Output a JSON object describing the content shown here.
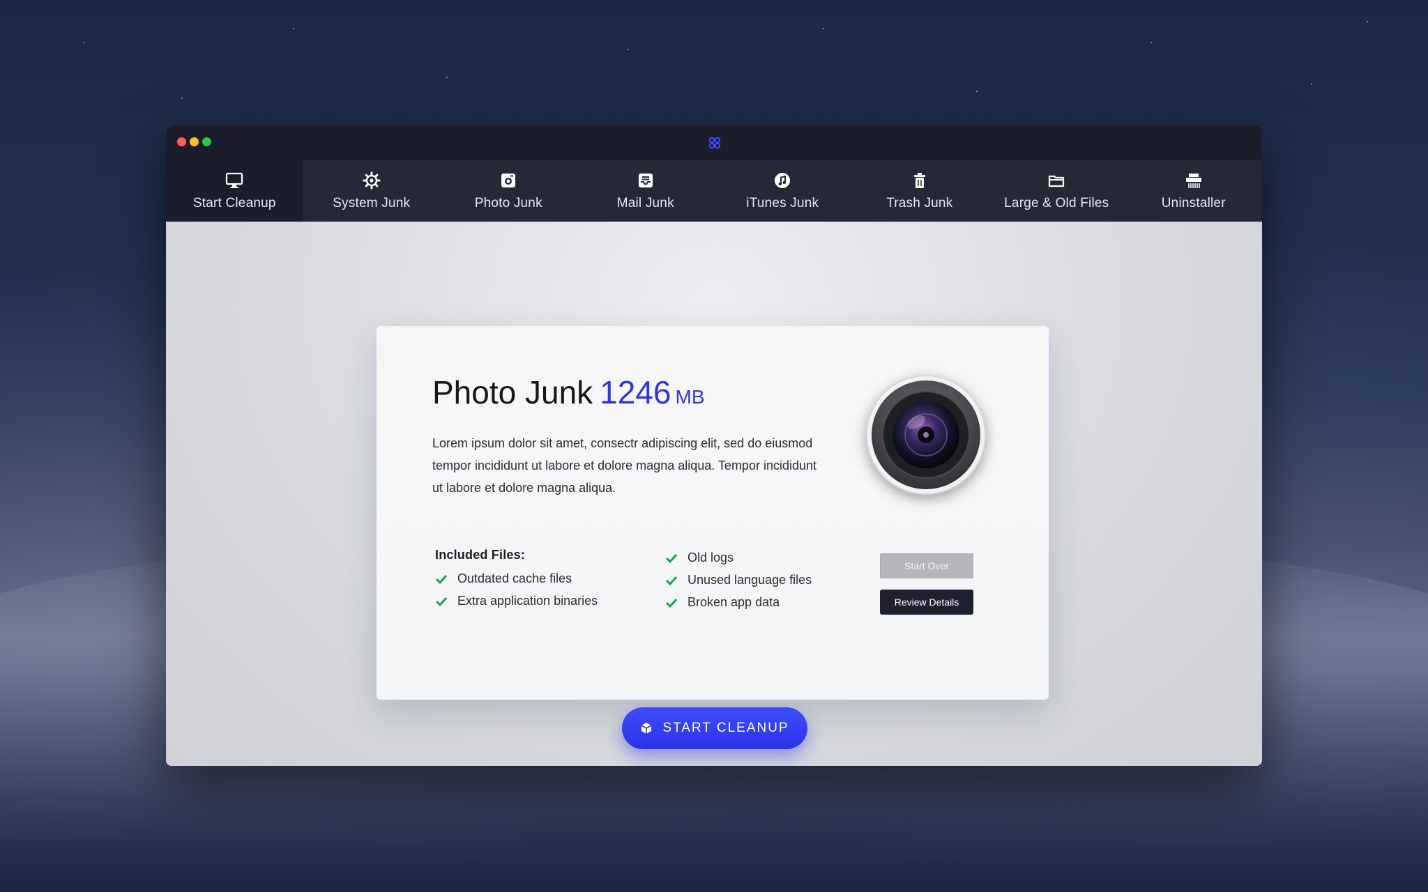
{
  "app": {
    "accent_color": "#2f35dd",
    "logo_icon": "app-logo-icon"
  },
  "nav": {
    "items": [
      {
        "label": "Start Cleanup",
        "icon": "monitor-icon",
        "active": true
      },
      {
        "label": "System Junk",
        "icon": "gear-icon",
        "active": false
      },
      {
        "label": "Photo Junk",
        "icon": "camera-icon",
        "active": false
      },
      {
        "label": "Mail Junk",
        "icon": "mail-icon",
        "active": false
      },
      {
        "label": "iTunes Junk",
        "icon": "music-note-icon",
        "active": false
      },
      {
        "label": "Trash Junk",
        "icon": "trash-icon",
        "active": false
      },
      {
        "label": "Large & Old Files",
        "icon": "folder-icon",
        "active": false
      },
      {
        "label": "Uninstaller",
        "icon": "shredder-icon",
        "active": false
      }
    ]
  },
  "card": {
    "title": "Photo Junk",
    "size_value": "1246",
    "size_unit": "MB",
    "description": "Lorem ipsum dolor sit amet, consectr adipiscing elit, sed do eiusmod tempor incididunt ut labore et dolore magna aliqua. Tempor incididunt ut labore et dolore magna aliqua.",
    "image_icon": "camera-lens-icon",
    "included_title": "Included Files:",
    "files_col1": [
      "Outdated cache files",
      "Extra application binaries"
    ],
    "files_col2": [
      "Old logs",
      "Unused language files",
      "Broken app data"
    ],
    "start_over_label": "Start Over",
    "review_label": "Review Details"
  },
  "cta": {
    "label": "START CLEANUP",
    "icon": "cube-icon"
  }
}
